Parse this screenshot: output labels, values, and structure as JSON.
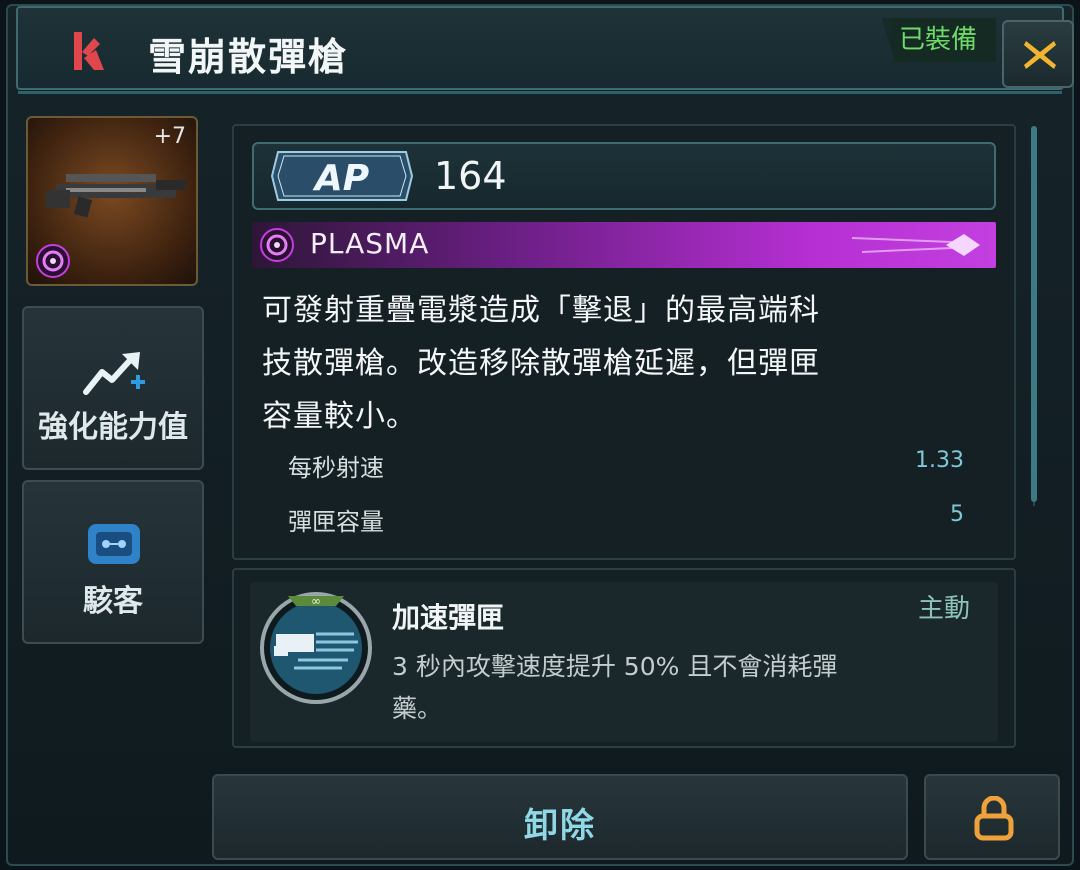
{
  "header": {
    "title": "雪崩散彈槍",
    "equipped_label": "已裝備"
  },
  "weapon_card": {
    "level": "+7"
  },
  "side_buttons": {
    "enhance_label": "強化能力值",
    "hacker_label": "駭客"
  },
  "ap": {
    "badge": "AP",
    "value": "164"
  },
  "damage_type": {
    "label": "PLASMA",
    "color": "#b52fd2"
  },
  "description": [
    "可發射重疊電漿造成「擊退」的最高端科",
    "技散彈槍。改造移除散彈槍延遲，但彈匣",
    "容量較小。"
  ],
  "stats": [
    {
      "name": "每秒射速",
      "value": "1.33"
    },
    {
      "name": "彈匣容量",
      "value": "5"
    }
  ],
  "skill": {
    "name": "加速彈匣",
    "type": "主動",
    "description_lines": [
      "3 秒內攻擊速度提升 50% 且不會消耗彈",
      "藥。"
    ]
  },
  "footer": {
    "unequip_label": "卸除"
  },
  "icons": {
    "logo": "brand-logo-icon",
    "close": "close-x-icon",
    "plasma": "plasma-icon",
    "enhance": "upgrade-arrow-icon",
    "hacker": "chip-icon",
    "skill": "infinite-ammo-icon",
    "lock": "lock-icon"
  }
}
